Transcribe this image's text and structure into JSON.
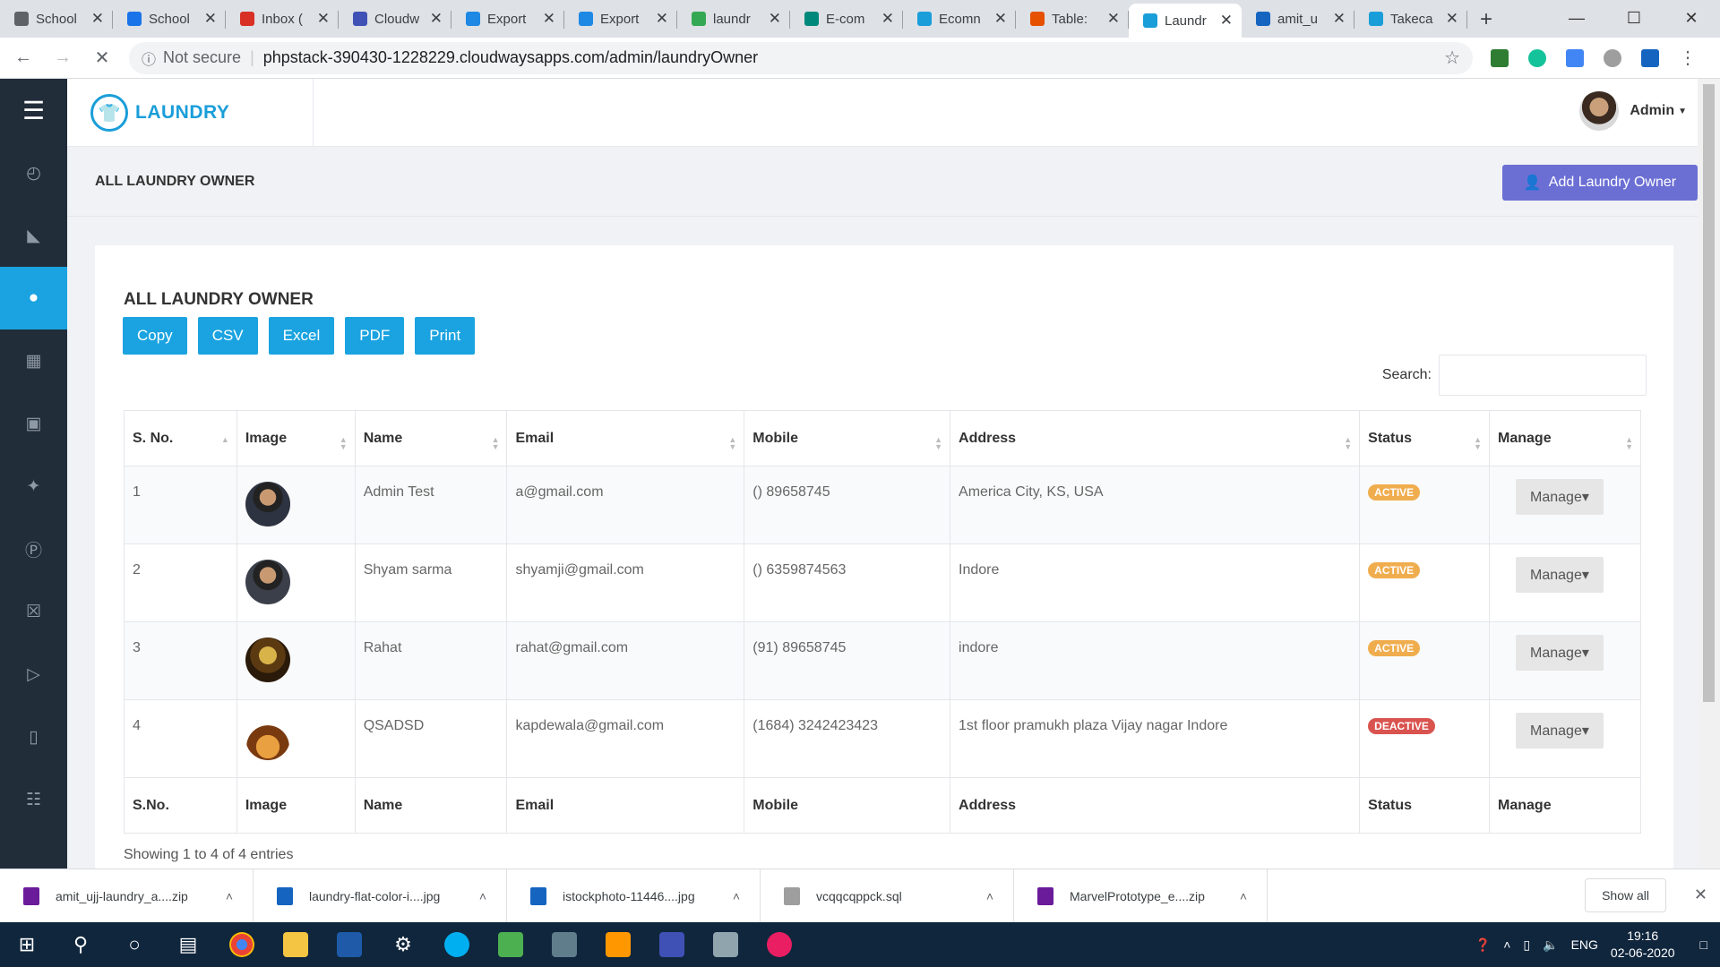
{
  "browser": {
    "tabs": [
      {
        "label": "School",
        "color": "#5f6368"
      },
      {
        "label": "School",
        "color": "#1a73e8"
      },
      {
        "label": "Inbox (",
        "color": "#d93025"
      },
      {
        "label": "Cloudw",
        "color": "#3f51b5"
      },
      {
        "label": "Export",
        "color": "#1e88e5"
      },
      {
        "label": "Export",
        "color": "#1e88e5"
      },
      {
        "label": "laundr",
        "color": "#34a853"
      },
      {
        "label": "E-com",
        "color": "#00897b"
      },
      {
        "label": "Ecomn",
        "color": "#1a9ed9"
      },
      {
        "label": "Table:",
        "color": "#e65100"
      },
      {
        "label": "Laundr",
        "color": "#1a9ed9"
      },
      {
        "label": "amit_u",
        "color": "#1565c0"
      },
      {
        "label": "Takeca",
        "color": "#1a9ed9"
      }
    ],
    "active_tab": 10,
    "not_secure": "Not secure",
    "url": "phpstack-390430-1228229.cloudwaysapps.com/admin/laundryOwner"
  },
  "app": {
    "brand": "LAUNDRY",
    "user": "Admin",
    "page_title": "ALL LAUNDRY OWNER",
    "add_button": "Add Laundry Owner",
    "sidebar_icons": [
      "dashboard-icon",
      "megaphone-icon",
      "user-icon",
      "table-icon",
      "ad-icon",
      "add-user-icon",
      "parking-icon",
      "gift-icon",
      "tag-icon",
      "receipt-icon",
      "cart-icon"
    ],
    "sidebar_active": 2
  },
  "card": {
    "title": "ALL LAUNDRY OWNER",
    "export_buttons": [
      "Copy",
      "CSV",
      "Excel",
      "PDF",
      "Print"
    ],
    "search_label": "Search:",
    "headers": [
      "S. No.",
      "Image",
      "Name",
      "Email",
      "Mobile",
      "Address",
      "Status",
      "Manage"
    ],
    "footer_headers": [
      "S.No.",
      "Image",
      "Name",
      "Email",
      "Mobile",
      "Address",
      "Status",
      "Manage"
    ],
    "rows": [
      {
        "sno": "1",
        "name": "Admin Test",
        "email": "a@gmail.com",
        "mobile": "() 89658745",
        "address": "America City, KS, USA",
        "status": "ACTIVE",
        "manage": "Manage"
      },
      {
        "sno": "2",
        "name": "Shyam sarma",
        "email": "shyamji@gmail.com",
        "mobile": "() 6359874563",
        "address": "Indore",
        "status": "ACTIVE",
        "manage": "Manage"
      },
      {
        "sno": "3",
        "name": "Rahat",
        "email": "rahat@gmail.com",
        "mobile": "(91) 89658745",
        "address": "indore",
        "status": "ACTIVE",
        "manage": "Manage"
      },
      {
        "sno": "4",
        "name": "QSADSD",
        "email": "kapdewala@gmail.com",
        "mobile": "(1684) 3242423423",
        "address": "1st floor pramukh plaza Vijay nagar Indore",
        "status": "DEACTIVE",
        "manage": "Manage"
      }
    ],
    "showing": "Showing 1 to 4 of 4 entries"
  },
  "downloads": {
    "items": [
      "amit_ujj-laundry_a....zip",
      "laundry-flat-color-i....jpg",
      "istockphoto-11446....jpg",
      "vcqqcqppck.sql",
      "MarvelPrototype_e....zip"
    ],
    "show_all": "Show all"
  },
  "taskbar": {
    "lang": "ENG",
    "time": "19:16",
    "date": "02-06-2020"
  }
}
